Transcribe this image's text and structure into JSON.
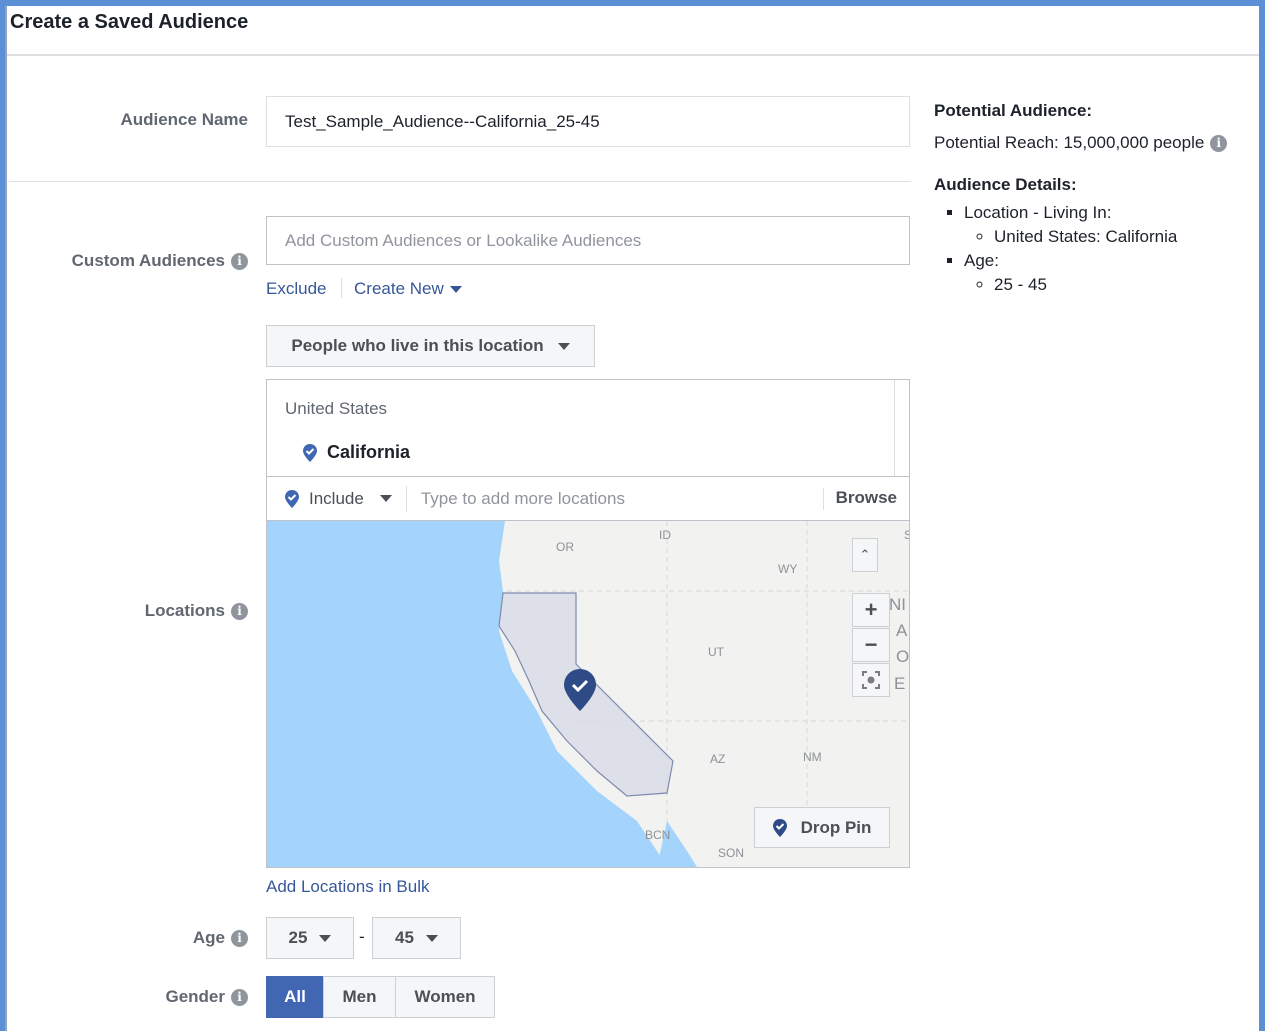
{
  "title": "Create a Saved Audience",
  "audience_name": {
    "label": "Audience Name",
    "value": "Test_Sample_Audience--California_25-45"
  },
  "custom_audiences": {
    "label": "Custom Audiences",
    "placeholder": "Add Custom Audiences or Lookalike Audiences",
    "exclude": "Exclude",
    "create_new": "Create New"
  },
  "locations": {
    "label": "Locations",
    "type_select": "People who live in this location",
    "country": "United States",
    "selected": "California",
    "include": "Include",
    "placeholder": "Type to add more locations",
    "browse": "Browse",
    "drop_pin": "Drop Pin",
    "bulk": "Add Locations in Bulk",
    "map_labels": {
      "or": "OR",
      "id": "ID",
      "wy": "WY",
      "ut": "UT",
      "az": "AZ",
      "nm": "NM",
      "bcn": "BCN",
      "son": "SON",
      "s": "S",
      "u1": "NI",
      "u2": "A",
      "u3": "O",
      "u4": "E"
    },
    "zoom_in": "+",
    "zoom_out": "−",
    "collapse": "⌃"
  },
  "age": {
    "label": "Age",
    "min": "25",
    "max": "45",
    "sep": "-"
  },
  "gender": {
    "label": "Gender",
    "options": [
      "All",
      "Men",
      "Women"
    ],
    "selected": "All"
  },
  "summary": {
    "potential_title": "Potential Audience:",
    "reach": "Potential Reach: 15,000,000 people",
    "details_title": "Audience Details:",
    "location_head": "Location - Living In:",
    "location_val": "United States: California",
    "age_head": "Age:",
    "age_val": "25 - 45"
  },
  "colors": {
    "accent": "#4267b2",
    "link": "#365899",
    "frame": "#5b8fd6"
  }
}
